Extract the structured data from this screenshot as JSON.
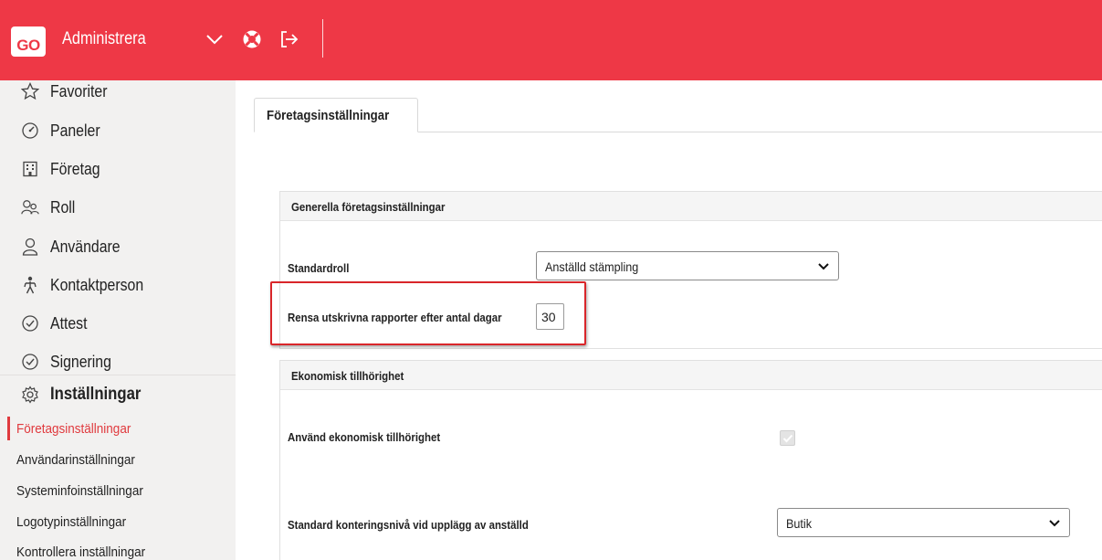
{
  "header": {
    "logo_text": "GO",
    "title": "Administrera",
    "icons": [
      "chevron-down-icon",
      "lifebuoy-icon",
      "logout-icon"
    ],
    "accent_color": "#ee3846"
  },
  "sidebar": {
    "items": [
      {
        "label": "Favoriter",
        "icon": "star-icon"
      },
      {
        "label": "Paneler",
        "icon": "gauge-icon"
      },
      {
        "label": "Företag",
        "icon": "building-icon"
      },
      {
        "label": "Roll",
        "icon": "users-icon"
      },
      {
        "label": "Användare",
        "icon": "user-icon"
      },
      {
        "label": "Kontaktperson",
        "icon": "person-icon"
      },
      {
        "label": "Attest",
        "icon": "check-circle-icon"
      },
      {
        "label": "Signering",
        "icon": "check-circle-icon"
      },
      {
        "label": "Inställningar",
        "icon": "gear-icon"
      }
    ],
    "sub_items": [
      {
        "label": "Företagsinställningar",
        "active": true
      },
      {
        "label": "Användarinställningar",
        "active": false
      },
      {
        "label": "Systeminfoinställningar",
        "active": false
      },
      {
        "label": "Logotypinställningar",
        "active": false
      },
      {
        "label": "Kontrollera inställningar",
        "active": false
      }
    ],
    "active_color": "#e03a3e"
  },
  "main": {
    "tab_label": "Företagsinställningar",
    "general": {
      "header": "Generella företagsinställningar",
      "default_role_label": "Standardroll",
      "default_role_value": "Anställd stämpling",
      "clear_reports_label": "Rensa utskrivna rapporter efter antal dagar",
      "clear_reports_value": "30"
    },
    "economic": {
      "header": "Ekonomisk tillhörighet",
      "use_label": "Använd ekonomisk tillhörighet",
      "use_checked": true,
      "account_level_label": "Standard konteringsnivå vid upplägg av anställd",
      "account_level_value": "Butik"
    }
  }
}
